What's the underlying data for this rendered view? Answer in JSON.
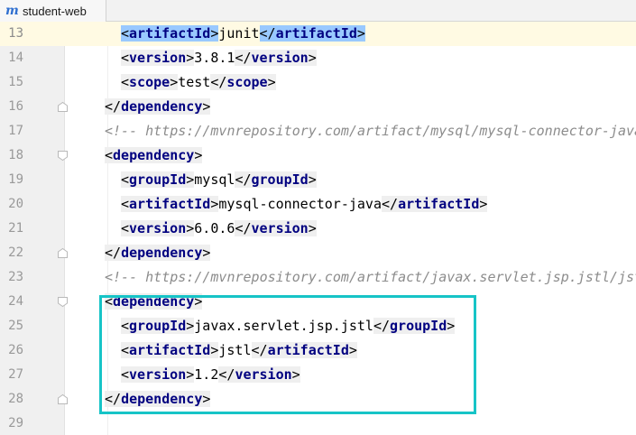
{
  "tab": {
    "icon": "m",
    "label": "student-web"
  },
  "editor": {
    "lines": [
      {
        "n": "13",
        "type": "element",
        "indent": 2,
        "tag": "artifactId",
        "value": "junit",
        "current": true,
        "highlight": true
      },
      {
        "n": "14",
        "type": "element",
        "indent": 2,
        "tag": "version",
        "value": "3.8.1"
      },
      {
        "n": "15",
        "type": "element",
        "indent": 2,
        "tag": "scope",
        "value": "test"
      },
      {
        "n": "16",
        "type": "close",
        "indent": 1,
        "tag": "dependency",
        "fold": "bottom"
      },
      {
        "n": "17",
        "type": "comment",
        "indent": 1,
        "text": "<!-- https://mvnrepository.com/artifact/mysql/mysql-connector-java"
      },
      {
        "n": "18",
        "type": "open",
        "indent": 1,
        "tag": "dependency",
        "fold": "top"
      },
      {
        "n": "19",
        "type": "element",
        "indent": 2,
        "tag": "groupId",
        "value": "mysql"
      },
      {
        "n": "20",
        "type": "element",
        "indent": 2,
        "tag": "artifactId",
        "value": "mysql-connector-java"
      },
      {
        "n": "21",
        "type": "element",
        "indent": 2,
        "tag": "version",
        "value": "6.0.6"
      },
      {
        "n": "22",
        "type": "close",
        "indent": 1,
        "tag": "dependency",
        "fold": "bottom"
      },
      {
        "n": "23",
        "type": "comment",
        "indent": 1,
        "text": "<!-- https://mvnrepository.com/artifact/javax.servlet.jsp.jstl/jst"
      },
      {
        "n": "24",
        "type": "open",
        "indent": 1,
        "tag": "dependency",
        "fold": "top"
      },
      {
        "n": "25",
        "type": "element",
        "indent": 2,
        "tag": "groupId",
        "value": "javax.servlet.jsp.jstl"
      },
      {
        "n": "26",
        "type": "element",
        "indent": 2,
        "tag": "artifactId",
        "value": "jstl"
      },
      {
        "n": "27",
        "type": "element",
        "indent": 2,
        "tag": "version",
        "value": "1.2"
      },
      {
        "n": "28",
        "type": "close",
        "indent": 1,
        "tag": "dependency",
        "fold": "bottom"
      },
      {
        "n": "29",
        "type": "empty",
        "indent": 1
      }
    ]
  },
  "colors": {
    "tag_name": "#000080",
    "comment": "#8c8c8c",
    "selection_outline": "#16c4c7",
    "current_line": "#fffae3",
    "highlight": "#99c9ff",
    "module_icon": "#2f6fd0"
  },
  "icons": {
    "module": "maven-module-icon",
    "fold_top": "fold-start-icon",
    "fold_bottom": "fold-end-icon"
  }
}
